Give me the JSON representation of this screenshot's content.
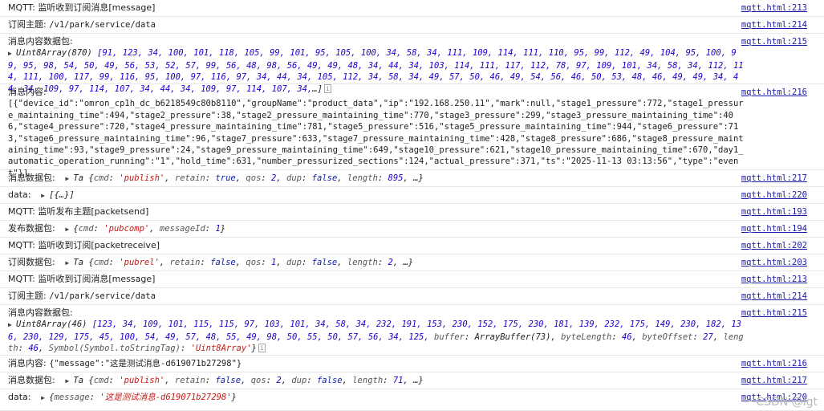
{
  "logs": [
    {
      "label": "MQTT: 监听收到订阅消息[message]",
      "source": "mqtt.html:213"
    },
    {
      "label": "订阅主题: ",
      "value": "/v1/park/service/data",
      "source": "mqtt.html:214"
    },
    {
      "label": "消息内容数据包:",
      "type_name": "Uint8Array(870)",
      "array_preview": "[91, 123, 34, 100, 101, 118, 105, 99, 101, 95, 105, 100, 34, 58, 34, 111, 109, 114, 111, 110, 95, 99, 112, 49, 104, 95, 100, 99, 95, 98, 54, 50, 49, 56, 53, 52, 57, 99, 56, 48, 98, 56, 49, 49, 48, 34, 44, 34, 103, 114, 111, 117, 112, 78, 97, 109, 101, 34, 58, 34, 112, 114, 111, 100, 117, 99, 116, 95, 100, 97, 116, 97, 34, 44, 34, 105, 112, 34, 58, 34, 49, 57, 50, 46, 49, 54, 56, 46, 50, 53, 48, 46, 49, 49, 34, 44, 34, 109, 97, 114, 107, 34, 44, 34, 109, 97, 114, 107, 34,",
      "ellipsis": "…]",
      "source": "mqtt.html:215"
    },
    {
      "label": "消息内容:",
      "payload": "[{\"device_id\":\"omron_cp1h_dc_b6218549c80b8110\",\"groupName\":\"product_data\",\"ip\":\"192.168.250.11\",\"mark\":null,\"stage1_pressure\":772,\"stage1_pressure_maintaining_time\":494,\"stage2_pressure\":38,\"stage2_pressure_maintaining_time\":770,\"stage3_pressure\":299,\"stage3_pressure_maintaining_time\":406,\"stage4_pressure\":720,\"stage4_pressure_maintaining_time\":781,\"stage5_pressure\":516,\"stage5_pressure_maintaining_time\":944,\"stage6_pressure\":713,\"stage6_pressure_maintaining_time\":96,\"stage7_pressure\":633,\"stage7_pressure_maintaining_time\":428,\"stage8_pressure\":686,\"stage8_pressure_maintaining_time\":93,\"stage9_pressure\":24,\"stage9_pressure_maintaining_time\":649,\"stage10_pressure\":621,\"stage10_pressure_maintaining_time\":670,\"day1_automatic_operation_running\":\"1\",\"hold_time\":631,\"number_pressurized_sections\":124,\"actual_pressure\":371,\"ts\":\"2025-11-13 03:13:56\",\"type\":\"event\"}]",
      "source": "mqtt.html:216"
    },
    {
      "label": "消息数据包:",
      "type_name": "Ta",
      "props": [
        {
          "k": "cmd",
          "v": "'publish'",
          "t": "s"
        },
        {
          "k": "retain",
          "v": "true",
          "t": "b"
        },
        {
          "k": "qos",
          "v": "2",
          "t": "n"
        },
        {
          "k": "dup",
          "v": "false",
          "t": "b"
        },
        {
          "k": "length",
          "v": "895",
          "t": "n"
        }
      ],
      "ellipsis": "…}",
      "source": "mqtt.html:217"
    },
    {
      "label": "data:",
      "object_preview": "[{…}]",
      "source": "mqtt.html:220"
    },
    {
      "label": "MQTT: 监听发布主题[packetsend]",
      "source": "mqtt.html:193"
    },
    {
      "label": "发布数据包:",
      "props": [
        {
          "k": "cmd",
          "v": "'pubcomp'",
          "t": "s"
        },
        {
          "k": "messageId",
          "v": "1",
          "t": "n"
        }
      ],
      "source": "mqtt.html:194"
    },
    {
      "label": "MQTT: 监听收到订阅[packetreceive]",
      "source": "mqtt.html:202"
    },
    {
      "label": "订阅数据包:",
      "type_name": "Ta",
      "props": [
        {
          "k": "cmd",
          "v": "'pubrel'",
          "t": "s"
        },
        {
          "k": "retain",
          "v": "false",
          "t": "b"
        },
        {
          "k": "qos",
          "v": "1",
          "t": "n"
        },
        {
          "k": "dup",
          "v": "false",
          "t": "b"
        },
        {
          "k": "length",
          "v": "2",
          "t": "n"
        }
      ],
      "ellipsis": "…}",
      "source": "mqtt.html:203"
    },
    {
      "label": "MQTT: 监听收到订阅消息[message]",
      "source": "mqtt.html:213"
    },
    {
      "label": "订阅主题: ",
      "value": "/v1/park/service/data",
      "source": "mqtt.html:214"
    },
    {
      "label": "消息内容数据包:",
      "type_name": "Uint8Array(46)",
      "array_preview": "[123, 34, 109, 101, 115, 115, 97, 103, 101, 34, 58, 34, 232, 191, 153, 230, 152, 175, 230, 181, 139, 232, 175, 149, 230, 182, 136, 230, 129, 175, 45, 100, 54, 49, 57, 48, 55, 49, 98, 50, 55, 50, 57, 56, 34, 125,",
      "array_tail": [
        {
          "k": "buffer",
          "v": "ArrayBuffer(73)",
          "t": "t"
        },
        {
          "k": "byteLength",
          "v": "46",
          "t": "n"
        },
        {
          "k": "byteOffset",
          "v": "27",
          "t": "n"
        },
        {
          "k": "length",
          "v": "46",
          "t": "n"
        },
        {
          "k": "Symbol(Symbol.toStringTag)",
          "v": "'Uint8Array'",
          "t": "s"
        }
      ],
      "ellipsis": "}",
      "source": "mqtt.html:215"
    },
    {
      "label": "消息内容: ",
      "payload": "{\"message\":\"这是测试消息-d619071b27298\"}",
      "source": "mqtt.html:216"
    },
    {
      "label": "消息数据包:",
      "type_name": "Ta",
      "props": [
        {
          "k": "cmd",
          "v": "'publish'",
          "t": "s"
        },
        {
          "k": "retain",
          "v": "false",
          "t": "b"
        },
        {
          "k": "qos",
          "v": "2",
          "t": "n"
        },
        {
          "k": "dup",
          "v": "false",
          "t": "b"
        },
        {
          "k": "length",
          "v": "71",
          "t": "n"
        }
      ],
      "ellipsis": "…}",
      "source": "mqtt.html:217"
    },
    {
      "label": "data:",
      "props": [
        {
          "k": "message",
          "v": "'这是测试消息-d619071b27298'",
          "t": "s"
        }
      ],
      "source": "mqtt.html:220"
    }
  ],
  "watermark": "CSDN @lgt"
}
